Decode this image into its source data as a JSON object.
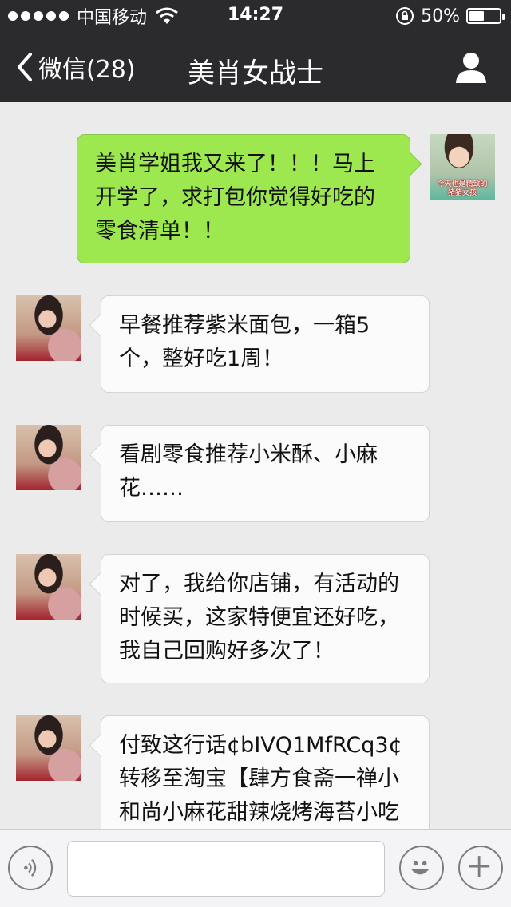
{
  "status_bar": {
    "carrier": "中国移动",
    "time": "14:27",
    "battery_text": "50%",
    "battery_level": 0.5
  },
  "nav": {
    "back_label": "微信(28)",
    "title": "美肖女战士"
  },
  "messages": [
    {
      "side": "outgoing",
      "avatar_caption": "今天也是精致的\n猪猪女孩",
      "text": "美肖学姐我又来了！！！马上\n开学了，求打包你觉得好吃的\n零食清单！！"
    },
    {
      "side": "incoming",
      "text": "早餐推荐紫米面包，一箱5\n个，整好吃1周！"
    },
    {
      "side": "incoming",
      "text": "看剧零食推荐小米酥、小麻\n花……"
    },
    {
      "side": "incoming",
      "text": "对了，我给你店铺，有活动的\n时候买，这家特便宜还好吃，\n我自己回购好多次了！"
    },
    {
      "side": "incoming",
      "text": "付致这行话¢bIVQ1MfRCq3¢\n转移至淘宝【肆方食斋一禅小\n和尚小麻花甜辣烧烤海苔小吃"
    }
  ],
  "input": {
    "value": "",
    "placeholder": ""
  },
  "colors": {
    "bar_bg": "#2b2b2d",
    "chat_bg": "#ebebeb",
    "outgoing_bubble": "#9de84f",
    "incoming_bubble": "#fbfbfb"
  },
  "icons": {
    "back": "chevron-left-icon",
    "user": "user-icon",
    "voice": "voice-icon",
    "emoji": "emoji-icon",
    "plus": "plus-icon"
  }
}
